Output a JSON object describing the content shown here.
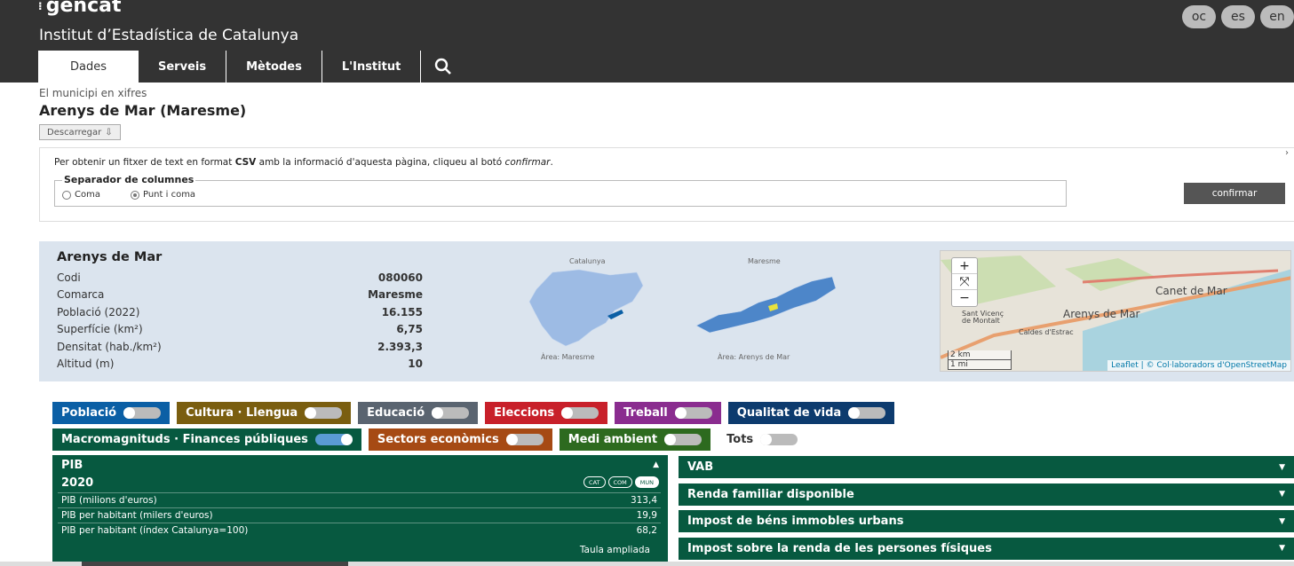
{
  "header": {
    "logo": "gencat",
    "institute": "Institut d’Estadística de Catalunya",
    "languages": [
      "oc",
      "es",
      "en"
    ],
    "nav": [
      "Dades",
      "Serveis",
      "Mètodes",
      "L'Institut"
    ],
    "search_icon": "search-icon"
  },
  "breadcrumb": "El municipi en xifres",
  "title": "Arenys de Mar (Maresme)",
  "download_label": "Descarregar",
  "csv": {
    "text_before": "Per obtenir un fitxer de text en format ",
    "format": "CSV",
    "text_after": " amb la informació d'aquesta pàgina, cliqueu al botó ",
    "action_word": "confirmar",
    "legend": "Separador de columnes",
    "option_coma": "Coma",
    "option_punt": "Punt i coma",
    "selected": "Punt i coma",
    "confirm_label": "confirmar"
  },
  "info": {
    "name": "Arenys de Mar",
    "rows": [
      {
        "label": "Codi",
        "value": "080060"
      },
      {
        "label": "Comarca",
        "value": "Maresme"
      },
      {
        "label": "Població (2022)",
        "value": "16.155"
      },
      {
        "label": "Superfície (km²)",
        "value": "6,75"
      },
      {
        "label": "Densitat (hab./km²)",
        "value": "2.393,3"
      },
      {
        "label": "Altitud (m)",
        "value": "10"
      }
    ],
    "map1_title": "Catalunya",
    "map1_caption": "Àrea: Maresme",
    "map2_title": "Maresme",
    "map2_caption": "Àrea: Arenys de Mar"
  },
  "leaflet": {
    "labels": [
      "Canet de Mar",
      "Sant Vicenç",
      "de Montalt",
      "Arenys de Mar",
      "Caldes d'Estrac"
    ],
    "scale_km": "2 km",
    "scale_mi": "1 mi",
    "attribution": "Leaflet | © Col·laboradors d'OpenStreetMap",
    "zoom_in": "+",
    "zoom_out": "−"
  },
  "chips": [
    {
      "label": "Població",
      "color": "#0b5fa5",
      "on": false
    },
    {
      "label": "Cultura · Llengua",
      "color": "#7a5e10",
      "on": false
    },
    {
      "label": "Educació",
      "color": "#5a6470",
      "on": false
    },
    {
      "label": "Eleccions",
      "color": "#c8202a",
      "on": false
    },
    {
      "label": "Treball",
      "color": "#8a2c8f",
      "on": false
    },
    {
      "label": "Qualitat de vida",
      "color": "#0d3b6e",
      "on": false
    },
    {
      "label": "Macromagnituds · Finances públiques",
      "color": "#075940",
      "on": true
    },
    {
      "label": "Sectors econòmics",
      "color": "#a64a14",
      "on": false
    },
    {
      "label": "Medi ambient",
      "color": "#2d6a1f",
      "on": false
    },
    {
      "label": "Tots",
      "color": "",
      "on": false
    }
  ],
  "pib": {
    "title": "PIB",
    "year": "2020",
    "pills": [
      "CAT",
      "COM",
      "MUN"
    ],
    "rows": [
      {
        "label": "PIB (milions d'euros)",
        "value": "313,4"
      },
      {
        "label": "PIB per habitant (milers d'euros)",
        "value": "19,9"
      },
      {
        "label": "PIB per habitant (índex Catalunya=100)",
        "value": "68,2"
      }
    ],
    "extended": "Taula ampliada"
  },
  "accordions": [
    "VAB",
    "Renda familiar disponible",
    "Impost de béns immobles urbans",
    "Impost sobre la renda de les persones físiques"
  ]
}
